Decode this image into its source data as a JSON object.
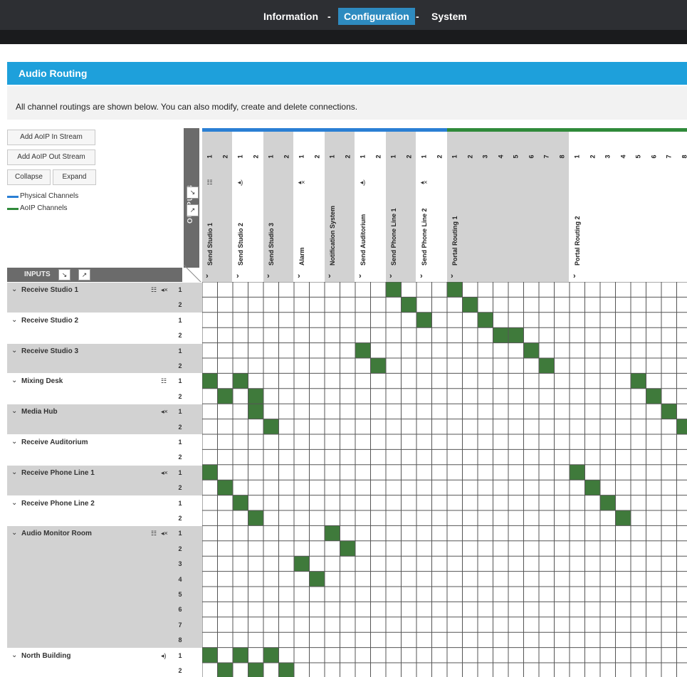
{
  "nav": {
    "items": [
      {
        "label": "Information",
        "active": false
      },
      {
        "label": "Configuration",
        "active": true
      },
      {
        "label": "System",
        "active": false
      }
    ],
    "separator": "-"
  },
  "section": {
    "title": "Audio Routing",
    "intro": "All channel routings are shown below. You can also modify, create and delete connections."
  },
  "buttons": {
    "add_in": "Add AoIP In Stream",
    "add_out": "Add AoIP Out Stream",
    "collapse": "Collapse",
    "expand": "Expand"
  },
  "legend": [
    {
      "label": "Physical Channels",
      "color": "#2a7fd4"
    },
    {
      "label": "AoIP Channels",
      "color": "#2f8a3a"
    }
  ],
  "labels": {
    "outputs": "OUTPUTS",
    "inputs": "INPUTS"
  },
  "colors": {
    "route": "#3f7a3b",
    "gridline": "#555555",
    "physical": "#2a7fd4",
    "aoip": "#2f8a3a",
    "header_shade": "#d2d2d2"
  },
  "outputs": [
    {
      "name": "Send Studio 1",
      "channels": [
        "1",
        "2"
      ],
      "icon": "mixer-icon",
      "shaded": true
    },
    {
      "name": "Send Studio 2",
      "channels": [
        "1",
        "2"
      ],
      "icon": "speaker-icon",
      "shaded": false
    },
    {
      "name": "Send Studio 3",
      "channels": [
        "1",
        "2"
      ],
      "icon": "",
      "shaded": true
    },
    {
      "name": "Alarm",
      "channels": [
        "1",
        "2"
      ],
      "icon": "mute-icon",
      "shaded": false
    },
    {
      "name": "Notification System",
      "channels": [
        "1",
        "2"
      ],
      "icon": "",
      "shaded": true
    },
    {
      "name": "Send Auditorium",
      "channels": [
        "1",
        "2"
      ],
      "icon": "speaker-icon",
      "shaded": false
    },
    {
      "name": "Send Phone Line 1",
      "channels": [
        "1",
        "2"
      ],
      "icon": "",
      "shaded": true
    },
    {
      "name": "Send Phone Line 2",
      "channels": [
        "1",
        "2"
      ],
      "icon": "mute-icon",
      "shaded": false
    },
    {
      "name": "Portal Routing 1",
      "channels": [
        "1",
        "2",
        "3",
        "4",
        "5",
        "6",
        "7",
        "8"
      ],
      "icon": "",
      "shaded": true
    },
    {
      "name": "Portal Routing 2",
      "channels": [
        "1",
        "2",
        "3",
        "4",
        "5",
        "6",
        "7",
        "8"
      ],
      "icon": "",
      "shaded": false
    }
  ],
  "inputs": [
    {
      "name": "Receive Studio 1",
      "channels": [
        "1",
        "2"
      ],
      "icons": "mixer-icon mute-icon",
      "shaded": true
    },
    {
      "name": "Receive Studio 2",
      "channels": [
        "1",
        "2"
      ],
      "icons": "",
      "shaded": false
    },
    {
      "name": "Receive Studio 3",
      "channels": [
        "1",
        "2"
      ],
      "icons": "",
      "shaded": true
    },
    {
      "name": "Mixing Desk",
      "channels": [
        "1",
        "2"
      ],
      "icons": "mixer-icon",
      "shaded": false
    },
    {
      "name": "Media Hub",
      "channels": [
        "1",
        "2"
      ],
      "icons": "mute-icon",
      "shaded": true
    },
    {
      "name": "Receive Auditorium",
      "channels": [
        "1",
        "2"
      ],
      "icons": "",
      "shaded": false
    },
    {
      "name": "Receive Phone Line 1",
      "channels": [
        "1",
        "2"
      ],
      "icons": "mute-icon",
      "shaded": true
    },
    {
      "name": "Receive Phone Line 2",
      "channels": [
        "1",
        "2"
      ],
      "icons": "",
      "shaded": false
    },
    {
      "name": "Audio Monitor Room",
      "channels": [
        "1",
        "2",
        "3",
        "4",
        "5",
        "6",
        "7",
        "8"
      ],
      "icons": "mixer-icon mute-icon",
      "shaded": true
    },
    {
      "name": "North Building",
      "channels": [
        "1",
        "2"
      ],
      "icons": "speaker-icon",
      "shaded": false
    }
  ],
  "routes": [
    [
      0,
      12
    ],
    [
      0,
      16
    ],
    [
      1,
      13
    ],
    [
      1,
      17
    ],
    [
      2,
      14
    ],
    [
      2,
      18
    ],
    [
      3,
      19
    ],
    [
      3,
      20
    ],
    [
      4,
      10
    ],
    [
      4,
      21
    ],
    [
      5,
      11
    ],
    [
      5,
      22
    ],
    [
      6,
      0
    ],
    [
      6,
      2
    ],
    [
      6,
      28
    ],
    [
      7,
      1
    ],
    [
      7,
      3
    ],
    [
      7,
      29
    ],
    [
      8,
      3
    ],
    [
      8,
      30
    ],
    [
      9,
      4
    ],
    [
      9,
      31
    ],
    [
      12,
      0
    ],
    [
      12,
      24
    ],
    [
      13,
      1
    ],
    [
      13,
      25
    ],
    [
      14,
      2
    ],
    [
      14,
      26
    ],
    [
      15,
      3
    ],
    [
      15,
      27
    ],
    [
      16,
      8
    ],
    [
      17,
      9
    ],
    [
      18,
      6
    ],
    [
      19,
      7
    ],
    [
      24,
      0
    ],
    [
      24,
      2
    ],
    [
      24,
      4
    ],
    [
      25,
      1
    ],
    [
      25,
      3
    ],
    [
      25,
      5
    ]
  ]
}
